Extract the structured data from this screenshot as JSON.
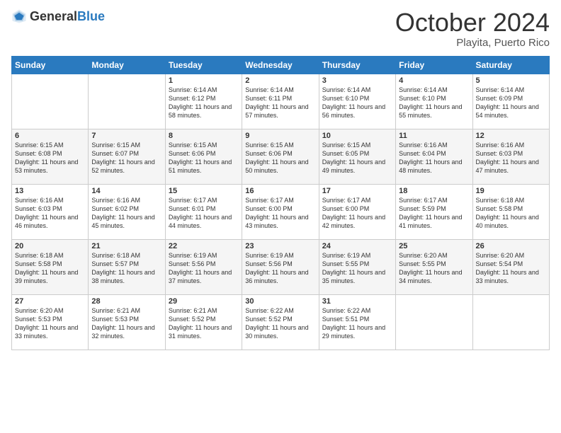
{
  "header": {
    "logo_general": "General",
    "logo_blue": "Blue",
    "month_year": "October 2024",
    "location": "Playita, Puerto Rico"
  },
  "days_of_week": [
    "Sunday",
    "Monday",
    "Tuesday",
    "Wednesday",
    "Thursday",
    "Friday",
    "Saturday"
  ],
  "weeks": [
    [
      {
        "day": "",
        "sunrise": "",
        "sunset": "",
        "daylight": ""
      },
      {
        "day": "",
        "sunrise": "",
        "sunset": "",
        "daylight": ""
      },
      {
        "day": "1",
        "sunrise": "Sunrise: 6:14 AM",
        "sunset": "Sunset: 6:12 PM",
        "daylight": "Daylight: 11 hours and 58 minutes."
      },
      {
        "day": "2",
        "sunrise": "Sunrise: 6:14 AM",
        "sunset": "Sunset: 6:11 PM",
        "daylight": "Daylight: 11 hours and 57 minutes."
      },
      {
        "day": "3",
        "sunrise": "Sunrise: 6:14 AM",
        "sunset": "Sunset: 6:10 PM",
        "daylight": "Daylight: 11 hours and 56 minutes."
      },
      {
        "day": "4",
        "sunrise": "Sunrise: 6:14 AM",
        "sunset": "Sunset: 6:10 PM",
        "daylight": "Daylight: 11 hours and 55 minutes."
      },
      {
        "day": "5",
        "sunrise": "Sunrise: 6:14 AM",
        "sunset": "Sunset: 6:09 PM",
        "daylight": "Daylight: 11 hours and 54 minutes."
      }
    ],
    [
      {
        "day": "6",
        "sunrise": "Sunrise: 6:15 AM",
        "sunset": "Sunset: 6:08 PM",
        "daylight": "Daylight: 11 hours and 53 minutes."
      },
      {
        "day": "7",
        "sunrise": "Sunrise: 6:15 AM",
        "sunset": "Sunset: 6:07 PM",
        "daylight": "Daylight: 11 hours and 52 minutes."
      },
      {
        "day": "8",
        "sunrise": "Sunrise: 6:15 AM",
        "sunset": "Sunset: 6:06 PM",
        "daylight": "Daylight: 11 hours and 51 minutes."
      },
      {
        "day": "9",
        "sunrise": "Sunrise: 6:15 AM",
        "sunset": "Sunset: 6:06 PM",
        "daylight": "Daylight: 11 hours and 50 minutes."
      },
      {
        "day": "10",
        "sunrise": "Sunrise: 6:15 AM",
        "sunset": "Sunset: 6:05 PM",
        "daylight": "Daylight: 11 hours and 49 minutes."
      },
      {
        "day": "11",
        "sunrise": "Sunrise: 6:16 AM",
        "sunset": "Sunset: 6:04 PM",
        "daylight": "Daylight: 11 hours and 48 minutes."
      },
      {
        "day": "12",
        "sunrise": "Sunrise: 6:16 AM",
        "sunset": "Sunset: 6:03 PM",
        "daylight": "Daylight: 11 hours and 47 minutes."
      }
    ],
    [
      {
        "day": "13",
        "sunrise": "Sunrise: 6:16 AM",
        "sunset": "Sunset: 6:03 PM",
        "daylight": "Daylight: 11 hours and 46 minutes."
      },
      {
        "day": "14",
        "sunrise": "Sunrise: 6:16 AM",
        "sunset": "Sunset: 6:02 PM",
        "daylight": "Daylight: 11 hours and 45 minutes."
      },
      {
        "day": "15",
        "sunrise": "Sunrise: 6:17 AM",
        "sunset": "Sunset: 6:01 PM",
        "daylight": "Daylight: 11 hours and 44 minutes."
      },
      {
        "day": "16",
        "sunrise": "Sunrise: 6:17 AM",
        "sunset": "Sunset: 6:00 PM",
        "daylight": "Daylight: 11 hours and 43 minutes."
      },
      {
        "day": "17",
        "sunrise": "Sunrise: 6:17 AM",
        "sunset": "Sunset: 6:00 PM",
        "daylight": "Daylight: 11 hours and 42 minutes."
      },
      {
        "day": "18",
        "sunrise": "Sunrise: 6:17 AM",
        "sunset": "Sunset: 5:59 PM",
        "daylight": "Daylight: 11 hours and 41 minutes."
      },
      {
        "day": "19",
        "sunrise": "Sunrise: 6:18 AM",
        "sunset": "Sunset: 5:58 PM",
        "daylight": "Daylight: 11 hours and 40 minutes."
      }
    ],
    [
      {
        "day": "20",
        "sunrise": "Sunrise: 6:18 AM",
        "sunset": "Sunset: 5:58 PM",
        "daylight": "Daylight: 11 hours and 39 minutes."
      },
      {
        "day": "21",
        "sunrise": "Sunrise: 6:18 AM",
        "sunset": "Sunset: 5:57 PM",
        "daylight": "Daylight: 11 hours and 38 minutes."
      },
      {
        "day": "22",
        "sunrise": "Sunrise: 6:19 AM",
        "sunset": "Sunset: 5:56 PM",
        "daylight": "Daylight: 11 hours and 37 minutes."
      },
      {
        "day": "23",
        "sunrise": "Sunrise: 6:19 AM",
        "sunset": "Sunset: 5:56 PM",
        "daylight": "Daylight: 11 hours and 36 minutes."
      },
      {
        "day": "24",
        "sunrise": "Sunrise: 6:19 AM",
        "sunset": "Sunset: 5:55 PM",
        "daylight": "Daylight: 11 hours and 35 minutes."
      },
      {
        "day": "25",
        "sunrise": "Sunrise: 6:20 AM",
        "sunset": "Sunset: 5:55 PM",
        "daylight": "Daylight: 11 hours and 34 minutes."
      },
      {
        "day": "26",
        "sunrise": "Sunrise: 6:20 AM",
        "sunset": "Sunset: 5:54 PM",
        "daylight": "Daylight: 11 hours and 33 minutes."
      }
    ],
    [
      {
        "day": "27",
        "sunrise": "Sunrise: 6:20 AM",
        "sunset": "Sunset: 5:53 PM",
        "daylight": "Daylight: 11 hours and 33 minutes."
      },
      {
        "day": "28",
        "sunrise": "Sunrise: 6:21 AM",
        "sunset": "Sunset: 5:53 PM",
        "daylight": "Daylight: 11 hours and 32 minutes."
      },
      {
        "day": "29",
        "sunrise": "Sunrise: 6:21 AM",
        "sunset": "Sunset: 5:52 PM",
        "daylight": "Daylight: 11 hours and 31 minutes."
      },
      {
        "day": "30",
        "sunrise": "Sunrise: 6:22 AM",
        "sunset": "Sunset: 5:52 PM",
        "daylight": "Daylight: 11 hours and 30 minutes."
      },
      {
        "day": "31",
        "sunrise": "Sunrise: 6:22 AM",
        "sunset": "Sunset: 5:51 PM",
        "daylight": "Daylight: 11 hours and 29 minutes."
      },
      {
        "day": "",
        "sunrise": "",
        "sunset": "",
        "daylight": ""
      },
      {
        "day": "",
        "sunrise": "",
        "sunset": "",
        "daylight": ""
      }
    ]
  ]
}
